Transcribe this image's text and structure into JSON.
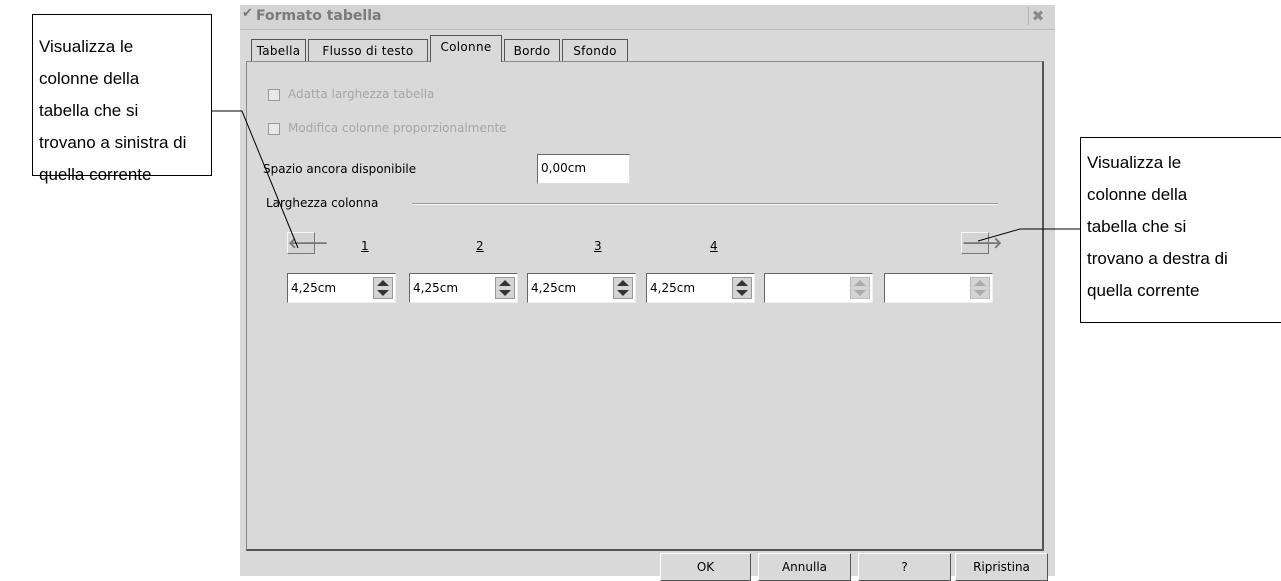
{
  "annotations": {
    "left": {
      "lines": [
        "Visualizza le",
        "colonne della",
        "tabella che si",
        "trovano a sinistra di",
        "quella corrente"
      ]
    },
    "right": {
      "lines": [
        "Visualizza le",
        "colonne della",
        "tabella che si",
        "trovano a destra di",
        "quella corrente"
      ]
    }
  },
  "dialog": {
    "title": "Formato tabella",
    "close_glyph": "✖",
    "tabs": [
      {
        "label": "Tabella"
      },
      {
        "label": "Flusso di testo"
      },
      {
        "label": "Colonne"
      },
      {
        "label": "Bordo"
      },
      {
        "label": "Sfondo"
      }
    ],
    "active_tab": "Colonne",
    "options": {
      "adapt_width": {
        "label": "Adatta larghezza tabella",
        "checked": false,
        "enabled": false
      },
      "proportional": {
        "label": "Modifica colonne proporzionalmente",
        "checked": false,
        "enabled": false
      }
    },
    "remaining_space": {
      "label": "Spazio ancora disponibile",
      "value": "0,00cm"
    },
    "column_width": {
      "group_label": "Larghezza colonna",
      "left_arrow": "🡐",
      "right_arrow": "🡒",
      "column_numbers": [
        "1",
        "2",
        "3",
        "4"
      ],
      "widths": [
        "4,25cm",
        "4,25cm",
        "4,25cm",
        "4,25cm",
        "",
        ""
      ]
    },
    "buttons": {
      "ok": "OK",
      "cancel": "Annulla",
      "help": "?",
      "reset": "Ripristina"
    }
  }
}
